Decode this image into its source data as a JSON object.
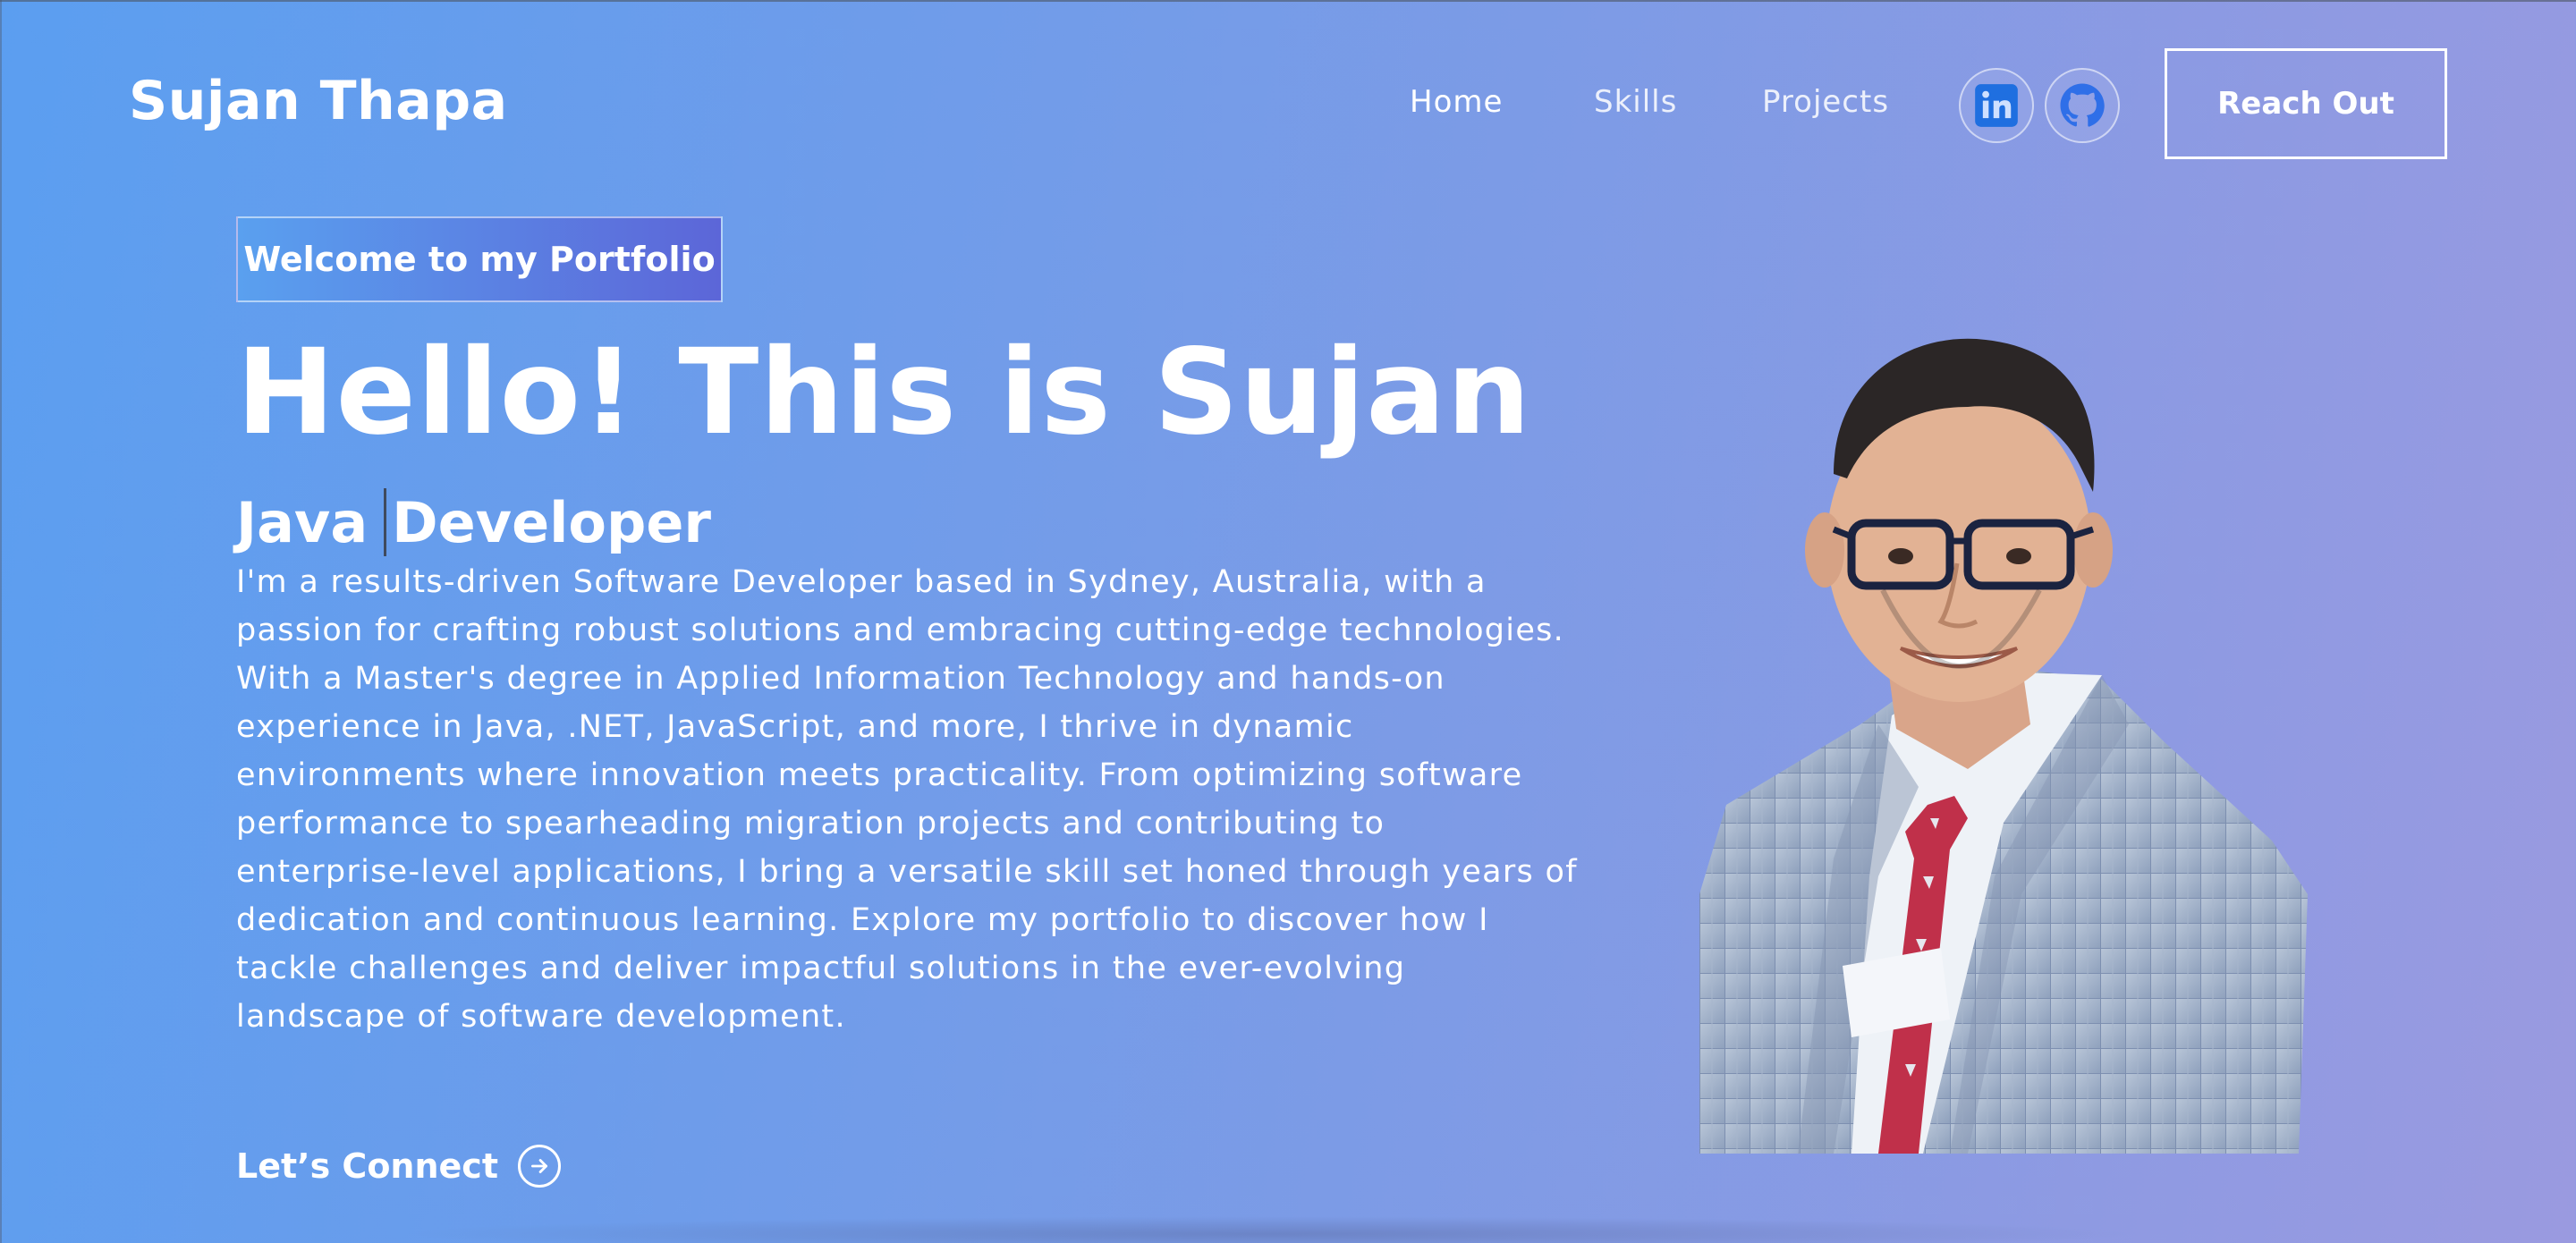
{
  "nav": {
    "brand": "Sujan Thapa",
    "links": [
      "Home",
      "Skills",
      "Projects"
    ],
    "social": [
      {
        "name": "LinkedIn",
        "icon": "linkedin-icon"
      },
      {
        "name": "GitHub",
        "icon": "github-icon"
      }
    ],
    "cta_label": "Reach Out"
  },
  "hero": {
    "tagline": "Welcome to my Portfolio",
    "headline": "Hello! This is Sujan",
    "role_part1": "Java",
    "role_part2": "Developer",
    "bio": "I'm a results-driven Software Developer based in Sydney, Australia, with a passion for crafting robust solutions and embracing cutting-edge technologies. With a Master's degree in Applied Information Technology and hands-on experience in Java, .NET, JavaScript, and more, I thrive in dynamic environments where innovation meets practicality. From optimizing software performance to spearheading migration projects and contributing to enterprise-level applications, I bring a versatile skill set honed through years of dedication and continuous learning. Explore my portfolio to discover how I tackle challenges and deliver impactful solutions in the ever-evolving landscape of software development.",
    "connect_label": "Let’s Connect",
    "connect_icon": "arrow-right-circle-icon"
  },
  "colors": {
    "bg_start": "#5b9ef0",
    "bg_end": "#9a9ae0",
    "linkedin": "#1f6fe0",
    "github": "#2f6fe8"
  }
}
